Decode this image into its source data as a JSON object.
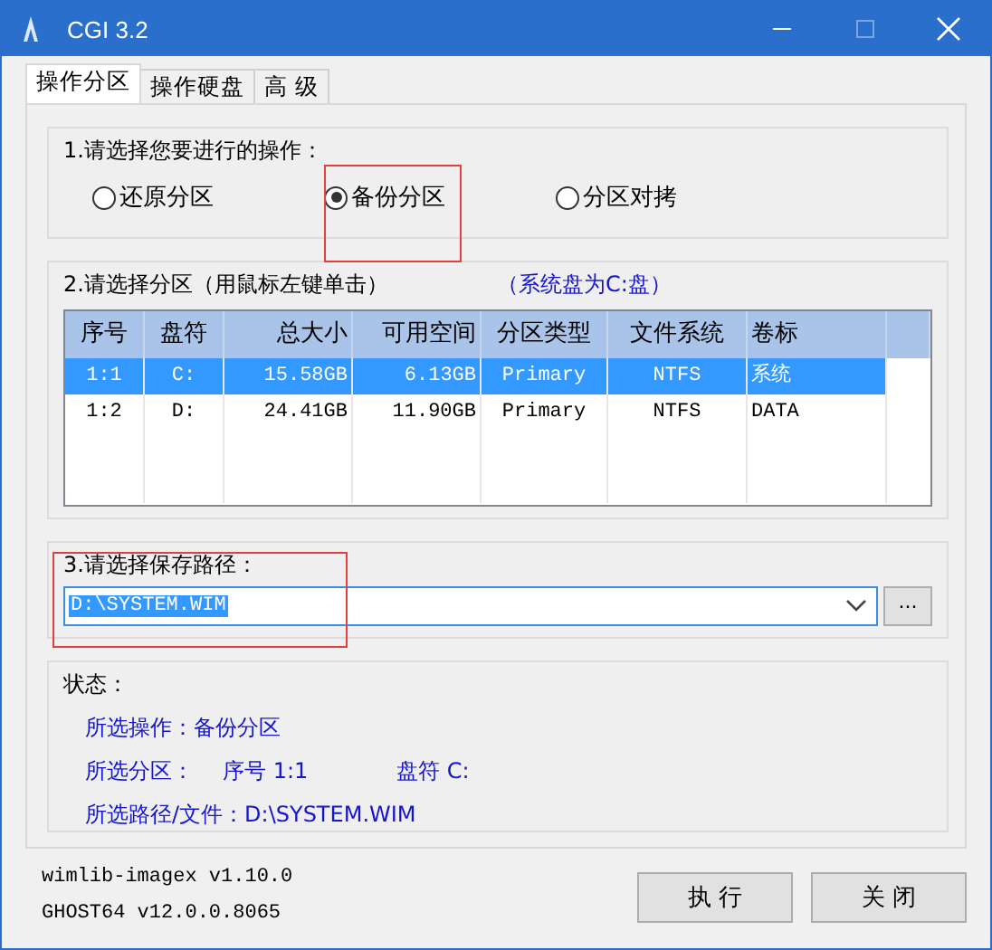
{
  "window": {
    "title": "CGI 3.2"
  },
  "tabs": [
    {
      "label": "操作分区",
      "selected": true
    },
    {
      "label": "操作硬盘",
      "selected": false
    },
    {
      "label": "高 级",
      "selected": false
    }
  ],
  "operation": {
    "label": "1.请选择您要进行的操作：",
    "options": [
      {
        "label": "还原分区",
        "selected": false
      },
      {
        "label": "备份分区",
        "selected": true
      },
      {
        "label": "分区对拷",
        "selected": false
      }
    ]
  },
  "partition": {
    "label": "2.请选择分区（用鼠标左键单击）",
    "hint": "（系统盘为C:盘）",
    "columns": [
      "序号",
      "盘符",
      "总大小",
      "可用空间",
      "分区类型",
      "文件系统",
      "卷标"
    ],
    "rows": [
      {
        "cells": [
          "1:1",
          "C:",
          "15.58GB",
          "6.13GB",
          "Primary",
          "NTFS",
          "系统"
        ],
        "selected": true
      },
      {
        "cells": [
          "1:2",
          "D:",
          "24.41GB",
          "11.90GB",
          "Primary",
          "NTFS",
          "DATA"
        ],
        "selected": false
      }
    ]
  },
  "path": {
    "label": "3.请选择保存路径：",
    "value": "D:\\SYSTEM.WIM",
    "browse": "..."
  },
  "status": {
    "label": "状态：",
    "lines": [
      [
        "所选操作：备份分区"
      ],
      [
        "所选分区：",
        "序号 1:1",
        "盘符 C:"
      ],
      [
        "所选路径/文件：D:\\SYSTEM.WIM"
      ]
    ]
  },
  "versions": [
    "wimlib-imagex v1.10.0",
    "GHOST64 v12.0.0.8065"
  ],
  "buttons": [
    "执 行",
    "关 闭"
  ]
}
